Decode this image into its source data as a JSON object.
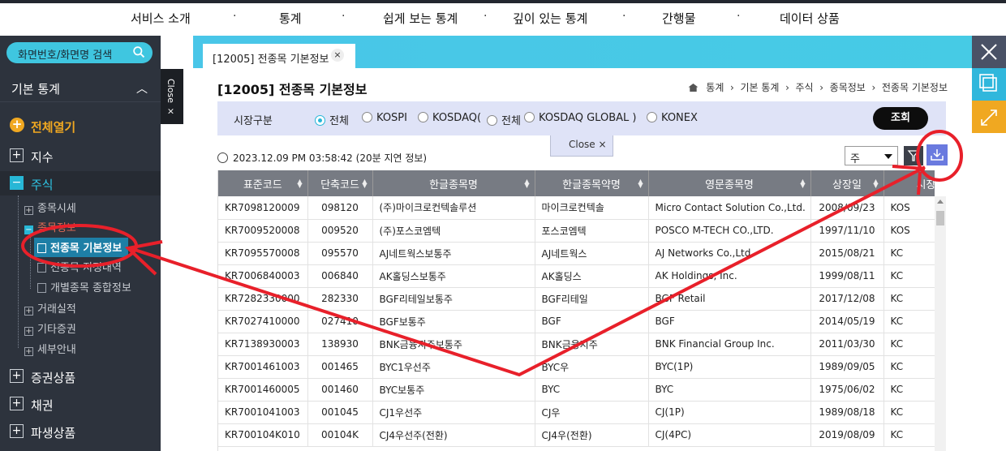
{
  "topnav": [
    "서비스 소개",
    "통계",
    "쉽게 보는 통계",
    "깊이 있는 통계",
    "간행물",
    "데이터 상품"
  ],
  "sidebar": {
    "search_placeholder": "화면번호/화면명 검색",
    "section_title": "기본 통계",
    "open_all": "전체열기",
    "items": [
      {
        "label": "지수"
      },
      {
        "label": "주식"
      },
      {
        "label": "증권상품"
      },
      {
        "label": "채권"
      },
      {
        "label": "파생상품"
      }
    ],
    "stock_sub": [
      "종목시세",
      "종목정보",
      "거래실적",
      "기타증권",
      "세부안내"
    ],
    "stock_info_sub": [
      "전종목 기본정보",
      "전종목 지정내역",
      "개별종목 종합정보"
    ]
  },
  "close_tab": "Close ×",
  "tab": {
    "label": "[12005] 전종목 기본정보",
    "close": "×"
  },
  "page": {
    "title": "[12005] 전종목 기본정보",
    "breadcrumb": [
      "통계",
      "기본 통계",
      "주식",
      "종목정보",
      "전종목 기본정보"
    ]
  },
  "filter": {
    "label": "시장구분",
    "options": [
      "전체",
      "KOSPI",
      "KOSDAQ(",
      "전체",
      "KOSDAQ GLOBAL )",
      "KONEX"
    ],
    "selected": "전체",
    "query_button": "조회"
  },
  "close_popup": "Close ×",
  "timestamp": "2023.12.09 PM 03:58:42",
  "delay_note": "(20분 지연 정보)",
  "select_value": "주",
  "table": {
    "headers": [
      "표준코드",
      "단축코드",
      "한글종목명",
      "한글종목약명",
      "영문종목명",
      "상장일",
      "시장"
    ],
    "rows": [
      [
        "KR7098120009",
        "098120",
        "(주)마이크로컨텍솔루션",
        "마이크로컨텍솔",
        "Micro Contact Solution Co.,Ltd.",
        "2008/09/23",
        "KOS"
      ],
      [
        "KR7009520008",
        "009520",
        "(주)포스코엠텍",
        "포스코엠텍",
        "POSCO M-TECH CO.,LTD.",
        "1997/11/10",
        "KOS"
      ],
      [
        "KR7095570008",
        "095570",
        "AJ네트웍스보통주",
        "AJ네트웍스",
        "AJ Networks Co.,Ltd.",
        "2015/08/21",
        "KC"
      ],
      [
        "KR7006840003",
        "006840",
        "AK홀딩스보통주",
        "AK홀딩스",
        "AK Holdings, Inc.",
        "1999/08/11",
        "KC"
      ],
      [
        "KR7282330000",
        "282330",
        "BGF리테일보통주",
        "BGF리테일",
        "BGF Retail",
        "2017/12/08",
        "KC"
      ],
      [
        "KR7027410000",
        "027410",
        "BGF보통주",
        "BGF",
        "BGF",
        "2014/05/19",
        "KC"
      ],
      [
        "KR7138930003",
        "138930",
        "BNK금융지주보통주",
        "BNK금융지주",
        "BNK Financial Group Inc.",
        "2011/03/30",
        "KC"
      ],
      [
        "KR7001461003",
        "001465",
        "BYC1우선주",
        "BYC우",
        "BYC(1P)",
        "1989/09/05",
        "KC"
      ],
      [
        "KR7001460005",
        "001460",
        "BYC보통주",
        "BYC",
        "BYC",
        "1975/06/02",
        "KC"
      ],
      [
        "KR7001041003",
        "001045",
        "CJ1우선주",
        "CJ우",
        "CJ(1P)",
        "1989/08/18",
        "KC"
      ],
      [
        "KR700104K010",
        "00104K",
        "CJ4우선주(전환)",
        "CJ4우(전환)",
        "CJ(4PC)",
        "2019/08/09",
        "KC"
      ]
    ]
  },
  "colors": {
    "accent": "#3fc6e0",
    "sidebar_bg": "#2d333d",
    "annotation": "#e8202a"
  }
}
